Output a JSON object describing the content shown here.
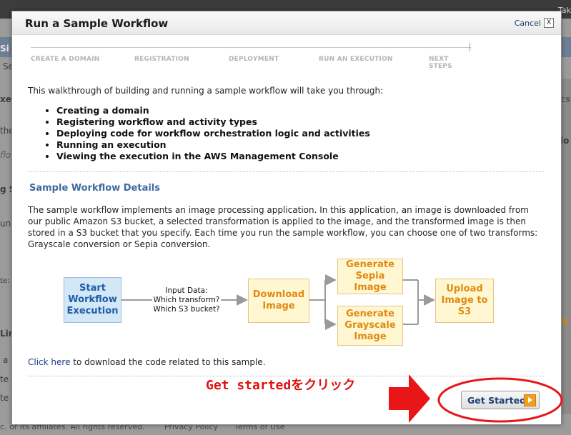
{
  "background": {
    "top_right_text": "Tak",
    "left_fragments": [
      "Si",
      "Se",
      "xe",
      "the",
      "flov",
      "g S",
      "un",
      "te:",
      "Lin",
      "a",
      "te",
      "te"
    ],
    "right_fragments": [
      "cs",
      "lo",
      "g"
    ],
    "footer_text": "c. or its affiliates. All rights reserved.",
    "footer_links": [
      "Privacy Policy",
      "Terms of Use"
    ]
  },
  "modal": {
    "title": "Run a Sample Workflow",
    "cancel_label": "Cancel",
    "close_glyph": "X"
  },
  "steps": [
    "CREATE A DOMAIN",
    "REGISTRATION",
    "DEPLOYMENT",
    "RUN AN EXECUTION",
    "NEXT STEPS"
  ],
  "intro": "This walkthrough of building and running a sample workflow will take you through:",
  "bullets": [
    "Creating a domain",
    "Registering workflow and activity types",
    "Deploying code for workflow orchestration logic and activities",
    "Running an execution",
    "Viewing the execution in the AWS Management Console"
  ],
  "details": {
    "title": "Sample Workflow Details",
    "description": "The sample workflow implements an image processing application. In this application, an image is downloaded from our public Amazon S3 bucket, a selected transformation is applied to the image, and the transformed image is then stored in a S3 bucket that you specify. Each time you run the sample workflow, you can choose one of two transforms: Grayscale conversion or Sepia conversion."
  },
  "diagram": {
    "start": "Start Workflow Execution",
    "input_lines": [
      "Input Data:",
      "Which transform?",
      "Which S3 bucket?"
    ],
    "download": "Download Image",
    "sepia": "Generate Sepia Image",
    "grayscale": "Generate Grayscale Image",
    "upload": "Upload Image to S3"
  },
  "download_code": {
    "link_text": "Click here",
    "rest_text": " to download the code related to this sample."
  },
  "annotation": "Get startedをクリック",
  "get_started_label": "Get Started",
  "colors": {
    "annotation_red": "#e01010",
    "diagram_orange": "#e08a12",
    "start_blue": "#1f5da6",
    "section_title_blue": "#3e6aa0"
  }
}
